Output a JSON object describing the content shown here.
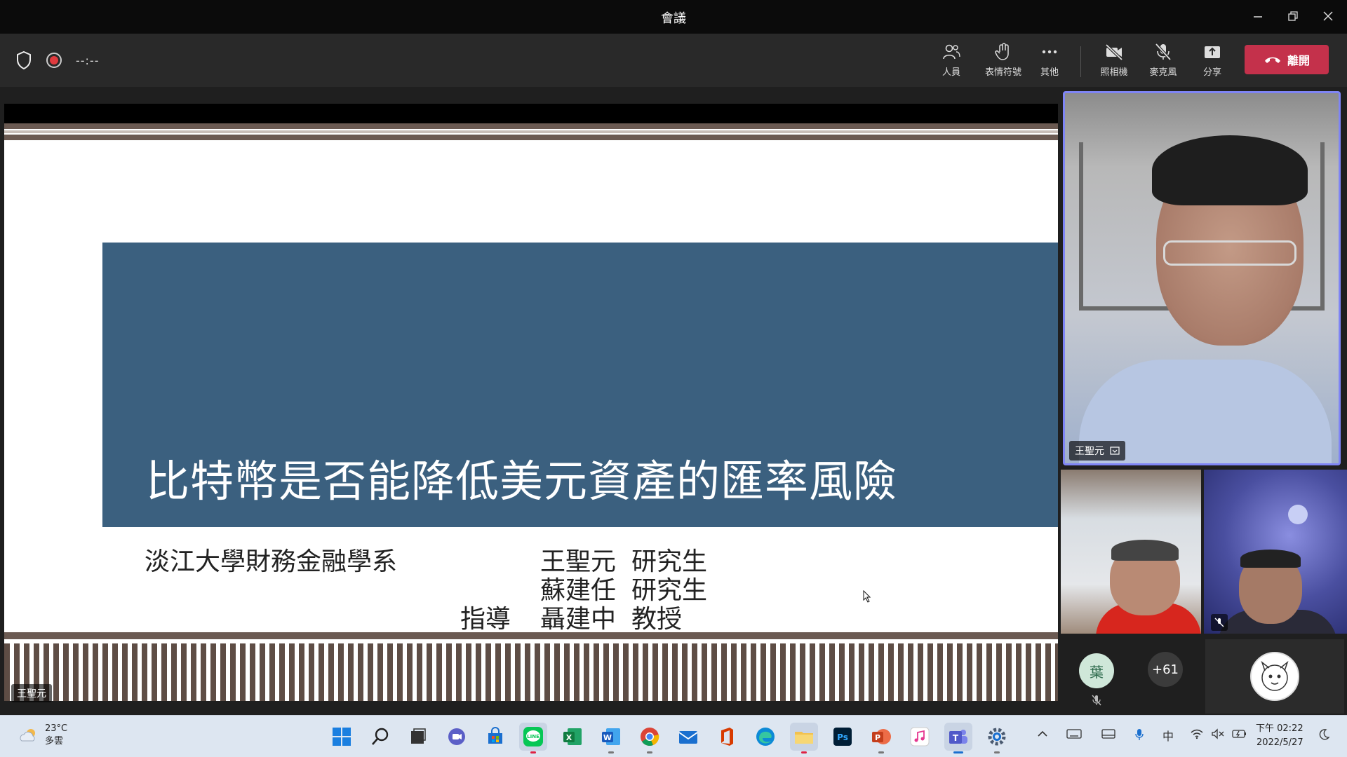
{
  "window": {
    "title": "會議"
  },
  "toolbar": {
    "timer": "--:--",
    "people_label": "人員",
    "reactions_label": "表情符號",
    "more_label": "其他",
    "camera_label": "照相機",
    "mic_label": "麥克風",
    "share_label": "分享",
    "leave_label": "離開"
  },
  "slide": {
    "title": "比特幣是否能降低美元資產的匯率風險",
    "department": "淡江大學財務金融學系",
    "authors": [
      {
        "name": "王聖元",
        "role": "研究生"
      },
      {
        "name": "蘇建任",
        "role": "研究生"
      }
    ],
    "advisor_prefix": "指導",
    "advisor": {
      "name": "聶建中",
      "role": "教授"
    }
  },
  "presenter_name": "王聖元",
  "participants": {
    "main_name": "王聖元",
    "avatar_initial": "葉",
    "overflow_count": "+61"
  },
  "taskbar": {
    "weather_temp": "23°C",
    "weather_desc": "多雲",
    "ime": "中",
    "time": "下午 02:22",
    "date": "2022/5/27"
  },
  "colors": {
    "leave_button": "#c4314b",
    "slide_band": "#3b607f",
    "active_speaker_border": "#7f85f5"
  }
}
